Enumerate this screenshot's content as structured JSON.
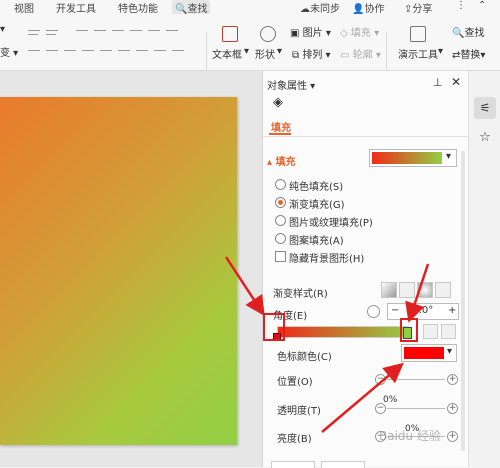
{
  "menubar": {
    "items": [
      "视图",
      "开发工具",
      "特色功能"
    ],
    "search": "查找",
    "sync": "未同步",
    "collab": "协作",
    "share": "分享"
  },
  "ribbon": {
    "textbox": "文本框",
    "shape": "形状",
    "arrange": "排列",
    "picture": "图片",
    "fill": "填充",
    "outline": "轮廓",
    "presenter": "演示工具",
    "find": "查找",
    "replace": "替换"
  },
  "pane": {
    "title": "对象属性",
    "tab_fill": "填充",
    "section_fill": "填充",
    "fill_options": [
      {
        "label": "纯色填充(S)",
        "checked": false
      },
      {
        "label": "渐变填充(G)",
        "checked": true
      },
      {
        "label": "图片或纹理填充(P)",
        "checked": false
      },
      {
        "label": "图案填充(A)",
        "checked": false
      }
    ],
    "hide_bg": "隐藏背景图形(H)",
    "gradient_style": "渐变样式(R)",
    "angle_label": "角度(E)",
    "angle_value": "45.0°",
    "stop_color_label": "色标颜色(C)",
    "position_label": "位置(O)",
    "transparency_label": "透明度(T)",
    "transparency_value": "0%",
    "brightness_label": "亮度(B)",
    "brightness_value": "0%",
    "watermark": "Baidu 经验",
    "colors": {
      "accent": "#e8632a",
      "gradient_start": "#f02a18",
      "gradient_end": "#92cf44",
      "stop_color": "#ff0000",
      "annotation": "#e02020"
    }
  }
}
